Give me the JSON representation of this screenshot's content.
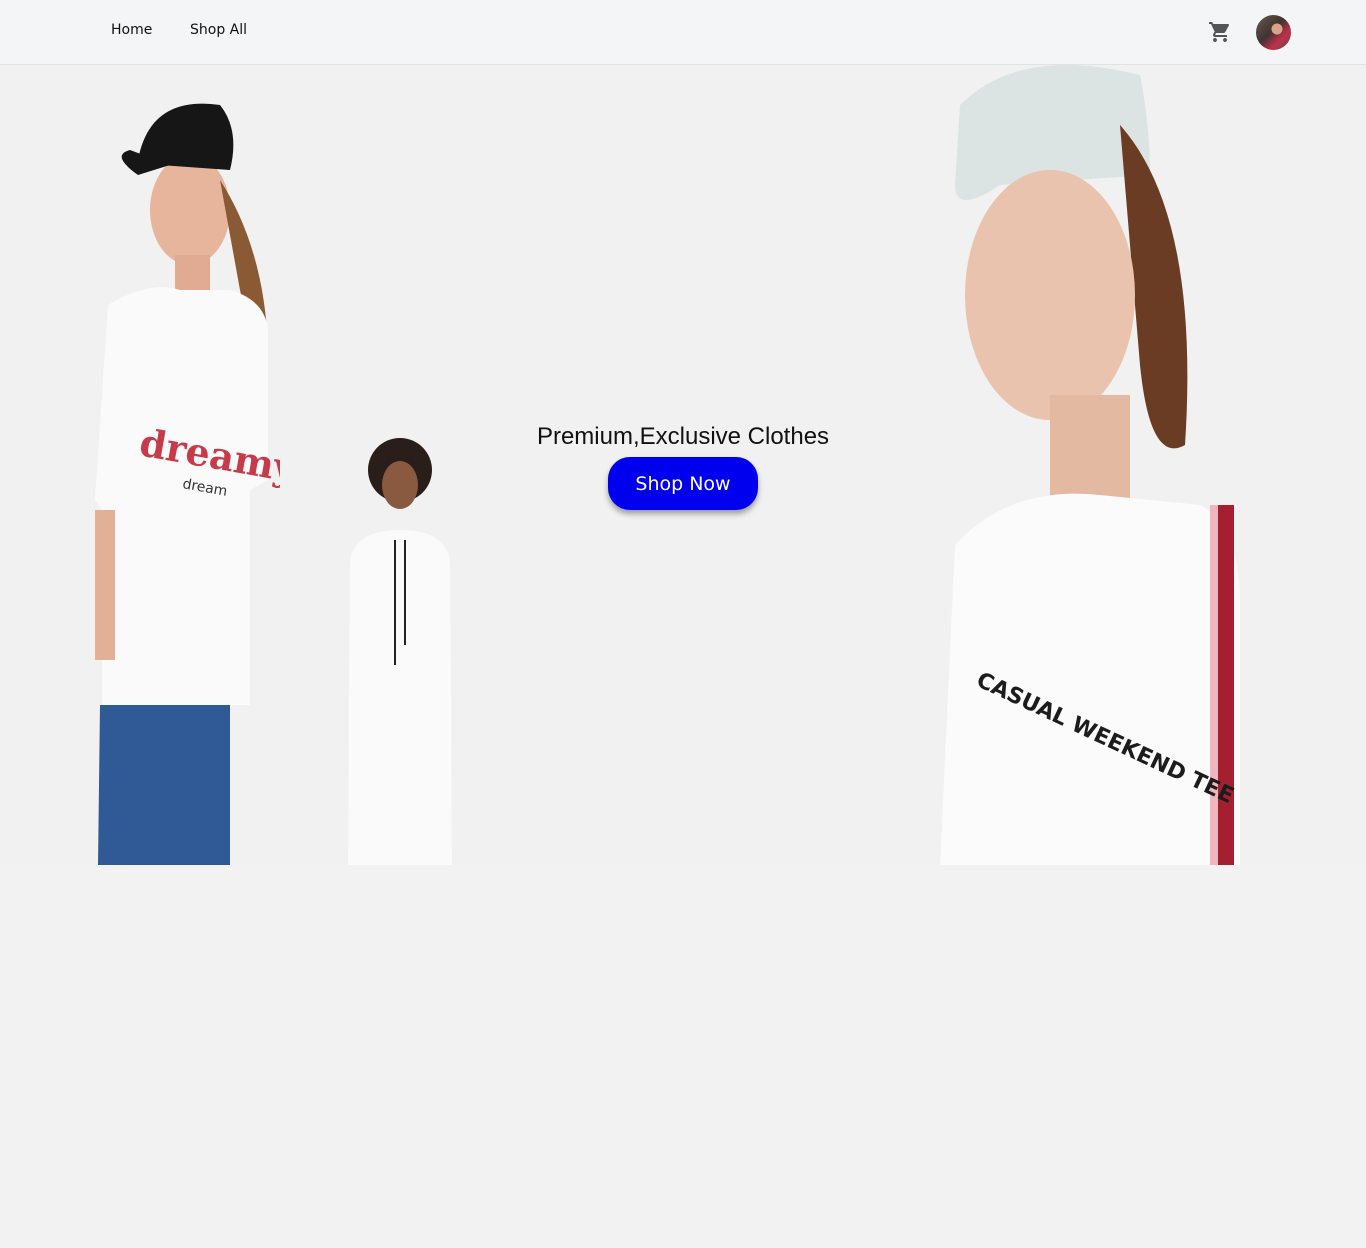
{
  "nav": {
    "home": "Home",
    "shop_all": "Shop All"
  },
  "icons": {
    "cart": "cart-icon",
    "avatar": "user-avatar"
  },
  "hero": {
    "title": "Premium,Exclusive Clothes",
    "cta": "Shop Now",
    "shirt_text_1": "dreamy",
    "shirt_text_1b": "dream",
    "shirt_text_2": "CASUAL WEEKEND TEE"
  },
  "colors": {
    "cta": "#0000ee",
    "background": "#f2f2f2",
    "navbar": "#f4f5f6"
  }
}
